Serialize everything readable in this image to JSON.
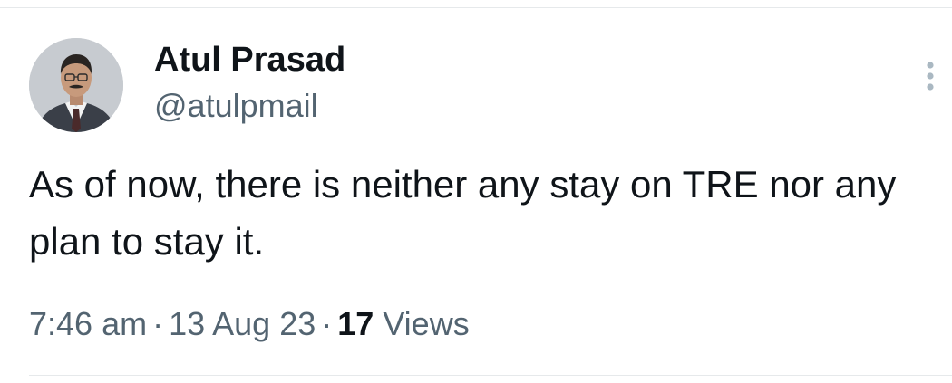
{
  "author": {
    "name": "Atul Prasad",
    "handle": "@atulpmail",
    "avatar_icon": "user-avatar-photo"
  },
  "tweet": {
    "text": "As of now, there is neither any stay on TRE nor any plan to stay it."
  },
  "meta": {
    "time": "7:46 am",
    "separator": "·",
    "date": "13 Aug 23",
    "views_count": "17",
    "views_label": "Views"
  },
  "more_icon": "more-vertical-icon",
  "colors": {
    "text_primary": "#0f1419",
    "text_secondary": "#536471",
    "divider": "#e6e9eb"
  }
}
